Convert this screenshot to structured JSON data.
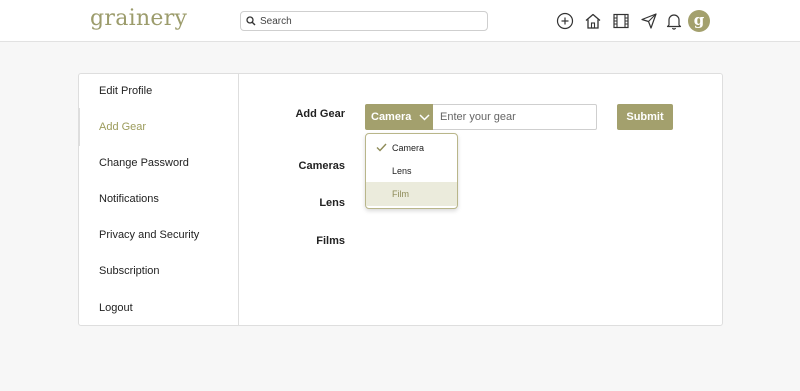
{
  "header": {
    "logo": "grainery",
    "search_placeholder": "Search",
    "avatar_letter": "g",
    "icons": [
      "plus-circle-icon",
      "home-icon",
      "film-icon",
      "send-icon",
      "bell-icon"
    ]
  },
  "sidebar": {
    "items": [
      {
        "label": "Edit Profile"
      },
      {
        "label": "Add Gear"
      },
      {
        "label": "Change Password"
      },
      {
        "label": "Notifications"
      },
      {
        "label": "Privacy and Security"
      },
      {
        "label": "Subscription"
      },
      {
        "label": "Logout"
      }
    ],
    "active_index": 1
  },
  "form": {
    "add_gear_label": "Add Gear",
    "select_value": "Camera",
    "input_placeholder": "Enter your gear",
    "submit_label": "Submit",
    "cameras_label": "Cameras",
    "lens_label": "Lens",
    "films_label": "Films"
  },
  "dropdown": {
    "options": [
      {
        "label": "Camera",
        "checked": true
      },
      {
        "label": "Lens",
        "checked": false
      },
      {
        "label": "Film",
        "checked": false,
        "highlighted": true
      }
    ]
  },
  "colors": {
    "accent": "#a3a06d",
    "accent_text": "#9c9c5c",
    "highlight_bg": "#ebebdc"
  }
}
